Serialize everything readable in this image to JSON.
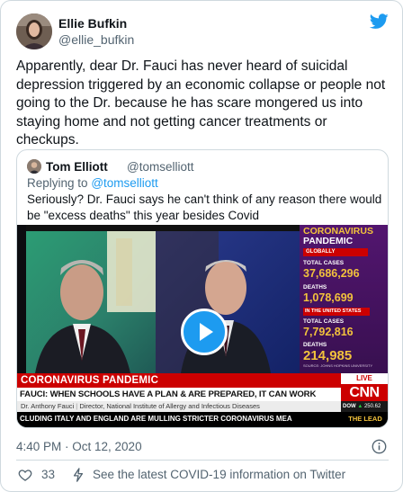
{
  "author": {
    "name": "Ellie Bufkin",
    "handle": "@ellie_bufkin"
  },
  "tweet": {
    "text": "Apparently, dear Dr. Fauci has never heard of suicidal depression triggered by an economic collapse or people not going to the Dr. because he has scare mongered us into staying home and not getting cancer treatments or checkups."
  },
  "quoted_tweet": {
    "name": "Tom Elliott",
    "handle": "@tomselliott",
    "replying_prefix": "Replying to",
    "replying_to": "@tomselliott",
    "text": "Seriously? Dr. Fauci says he can't think of any reason there would be \"excess deaths\" this year besides Covid"
  },
  "video": {
    "sidebar_title_1": "CORONAVIRUS",
    "sidebar_title_2": "PANDEMIC",
    "globally_label": "GLOBALLY",
    "total_cases_label": "TOTAL CASES",
    "global_cases": "37,686,296",
    "deaths_label": "DEATHS",
    "global_deaths": "1,078,699",
    "us_label": "IN THE UNITED STATES",
    "us_cases": "7,792,816",
    "us_deaths": "214,985",
    "source": "SOURCE: JOHNS HOPKINS UNIVERSITY",
    "banner_red": "CORONAVIRUS PANDEMIC",
    "banner_headline": "FAUCI: WHEN SCHOOLS HAVE A PLAN & ARE PREPARED, IT CAN WORK",
    "speaker_name": "Dr. Anthony Fauci",
    "speaker_title": "Director, National Institute of Allergy and Infectious Diseases",
    "ticker": "CLUDING ITALY AND ENGLAND ARE MULLING STRICTER CORONAVIRUS MEA",
    "live_label": "LIVE",
    "network": "CNN",
    "dow_label": "DOW",
    "dow_value": "250.62",
    "show_name": "THE LEAD"
  },
  "footer": {
    "timestamp": "4:40 PM · Oct 12, 2020",
    "like_count": "33",
    "covid_link": "See the latest COVID-19 information on Twitter"
  },
  "colors": {
    "accent": "#1d9bf0",
    "text_primary": "#0f1419",
    "text_secondary": "#536471",
    "border": "#cfd9de",
    "cnn_red": "#cc0000"
  }
}
